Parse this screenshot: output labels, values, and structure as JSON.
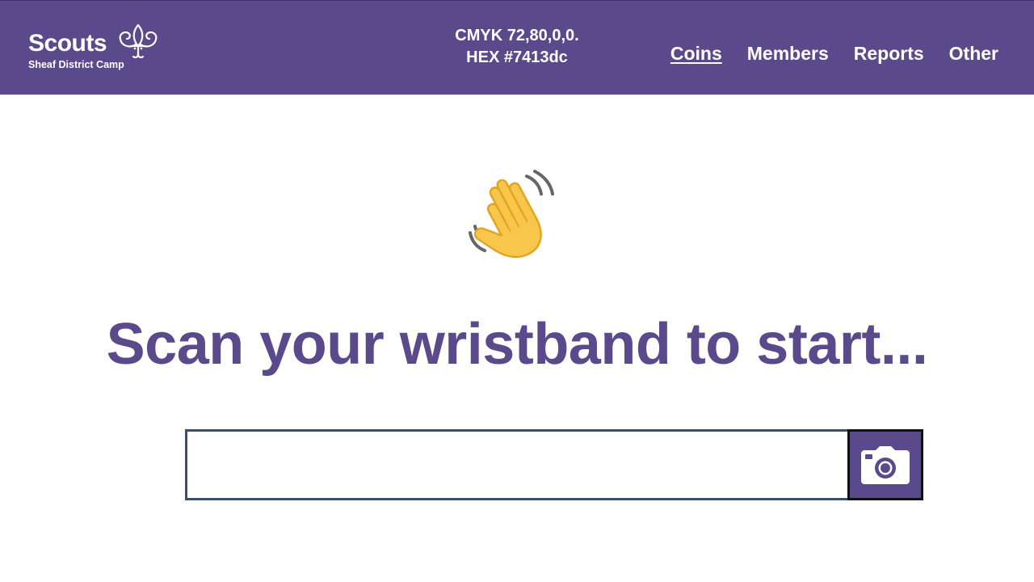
{
  "header": {
    "logo": {
      "word": "Scouts",
      "subtitle": "Sheaf District Camp"
    },
    "color_info": {
      "cmyk": "CMYK 72,80,0,0.",
      "hex": "HEX #7413dc"
    },
    "nav": [
      {
        "label": "Coins",
        "active": true
      },
      {
        "label": "Members",
        "active": false
      },
      {
        "label": "Reports",
        "active": false
      },
      {
        "label": "Other",
        "active": false
      }
    ]
  },
  "main": {
    "wave_icon": "waving-hand-emoji",
    "headline": "Scan your wristband to start...",
    "scan_input": {
      "value": "",
      "placeholder": ""
    },
    "camera_button_icon": "camera-icon"
  },
  "colors": {
    "brand_purple": "#5b4a8b",
    "input_border": "#3b5071",
    "emoji_yellow": "#f7c64a"
  }
}
